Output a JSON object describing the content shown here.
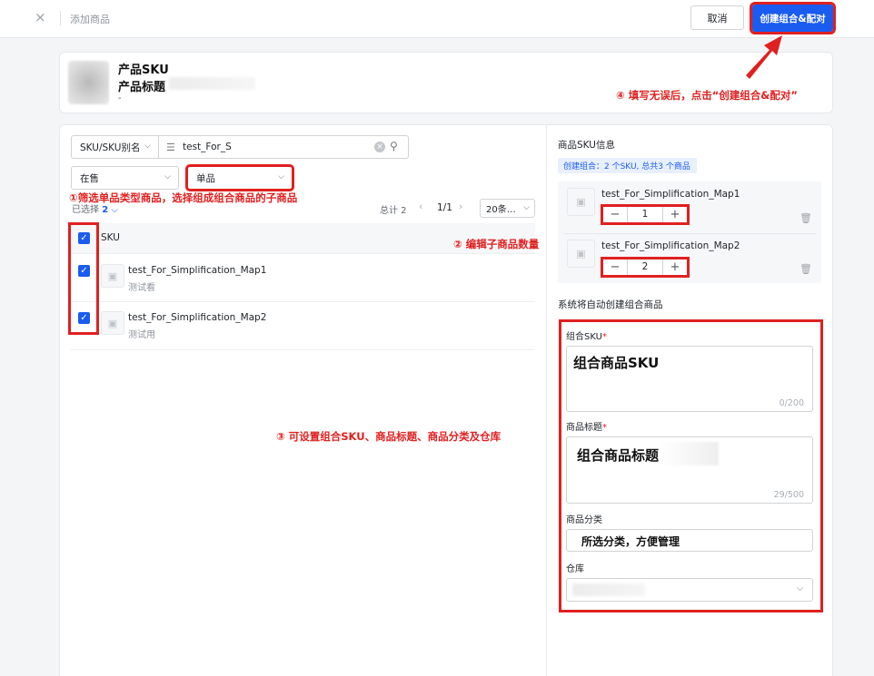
{
  "topbar": {
    "close_icon": "×",
    "title": "添加商品",
    "cancel_label": "取消",
    "create_label": "创建组合&配对"
  },
  "product": {
    "sku": "产品SKU",
    "title": "产品标题",
    "dash": "-"
  },
  "annotations": {
    "note1": "①筛选单品类型商品，选择组成组合商品的子商品",
    "note2": "② 编辑子商品数量",
    "note3": "③ 可设置组合SKU、商品标题、商品分类及仓库",
    "note4": "④ 填写无误后，点击“创建组合&配对”"
  },
  "filters": {
    "search_field": "SKU/SKU别名",
    "search_value": "test_For_S",
    "status": "在售",
    "type": "单品"
  },
  "list": {
    "selected_label": "已选择",
    "selected_count": "2",
    "total": "总计 2",
    "page": "1/1",
    "page_size": "20条…",
    "header_sku": "SKU",
    "items": [
      {
        "name": "test_For_Simplification_Map1",
        "sub": "测试看"
      },
      {
        "name": "test_For_Simplification_Map2",
        "sub": "测试用"
      }
    ]
  },
  "right": {
    "sku_info_title": "商品SKU信息",
    "combo_tag": "创建组合：2 个SKU, 总共3 个商品",
    "sku_items": [
      {
        "name": "test_For_Simplification_Map1",
        "qty": "1"
      },
      {
        "name": "test_For_Simplification_Map2",
        "qty": "2"
      }
    ],
    "auto_title": "系统将自动创建组合商品",
    "combo_sku_label": "组合SKU",
    "combo_sku_value": "组合商品SKU",
    "combo_sku_count": "0/200",
    "title_label": "商品标题",
    "title_value": "组合商品标题",
    "title_count": "29/500",
    "category_label": "商品分类",
    "category_value": "所选分类，方便管理",
    "warehouse_label": "仓库",
    "required_mark": "*"
  },
  "colors": {
    "primary": "#1a5cf0",
    "annotation_red": "#e02020"
  }
}
